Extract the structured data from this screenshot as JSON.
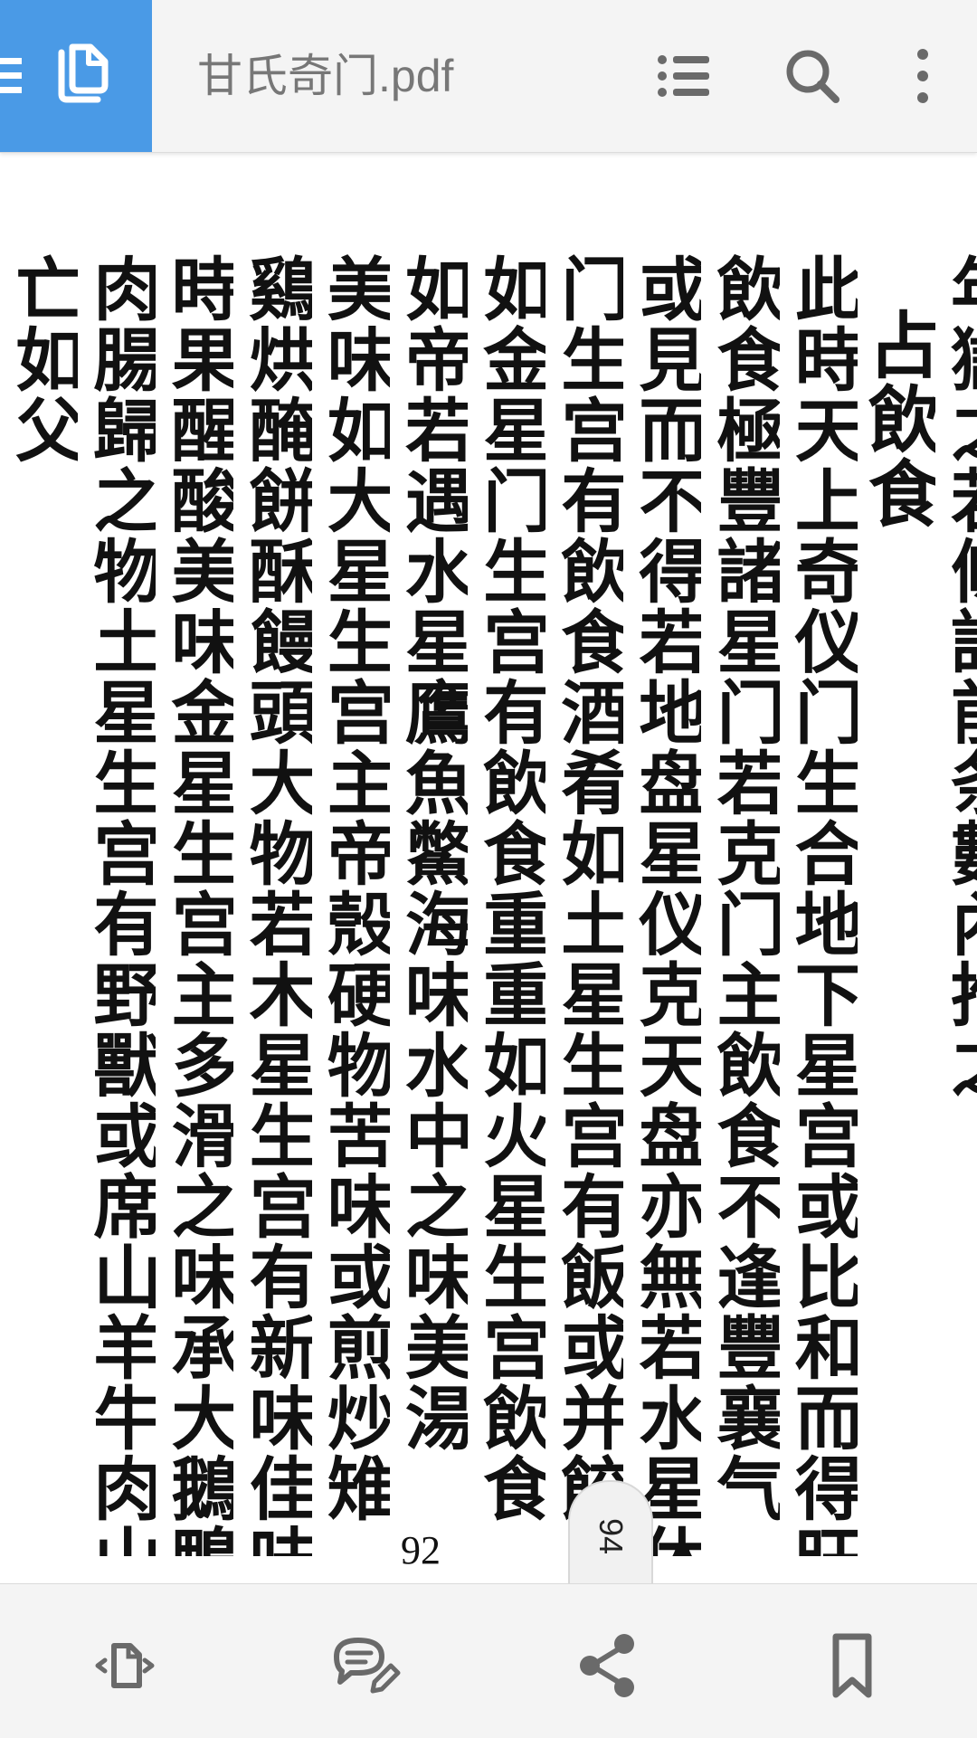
{
  "app": {
    "title": "甘氏奇门.pdf",
    "accent_color": "#4a9ae6",
    "icon_color": "#6a6a6a"
  },
  "toolbar": {
    "menu_icon": "menu-icon",
    "pages_icon": "pages-icon",
    "outline_icon": "list-icon",
    "search_icon": "search-icon",
    "more_icon": "more-vert-icon"
  },
  "document": {
    "columns": [
      "年獄之若條詳前条數內推之",
      "占飲食",
      "此時天上奇仪门生合地下星宫或比和而得旺气",
      "飲食極豐諸星门若克门主飲食不逢豐襄气",
      "或見而不得若地盘星仪克天盘亦無若水星休",
      "门生宫有飲食酒肴如土星生宫有飯或并餃果",
      "如金星门生宫有飲食重重如火星生宫飲食",
      "如帝若遇水星鷹魚鱉海味水中之味美湯",
      "美味如大星生宫主帝殼硬物苦味或煎炒雉",
      "鷄烘醃餅酥饅頭大物若木星生宫有新味佳味",
      "時果醒酸美味金星生宫主多滑之味承大鵝鴨鷄",
      "肉腸歸之物土星生宫有野獸或席山羊牛肉山菜",
      "亡如父"
    ],
    "page_number": "92",
    "page_tab": "94"
  },
  "bottombar": {
    "rotate_icon": "page-rotate-icon",
    "comment_icon": "comment-edit-icon",
    "share_icon": "share-icon",
    "bookmark_icon": "bookmark-icon"
  }
}
